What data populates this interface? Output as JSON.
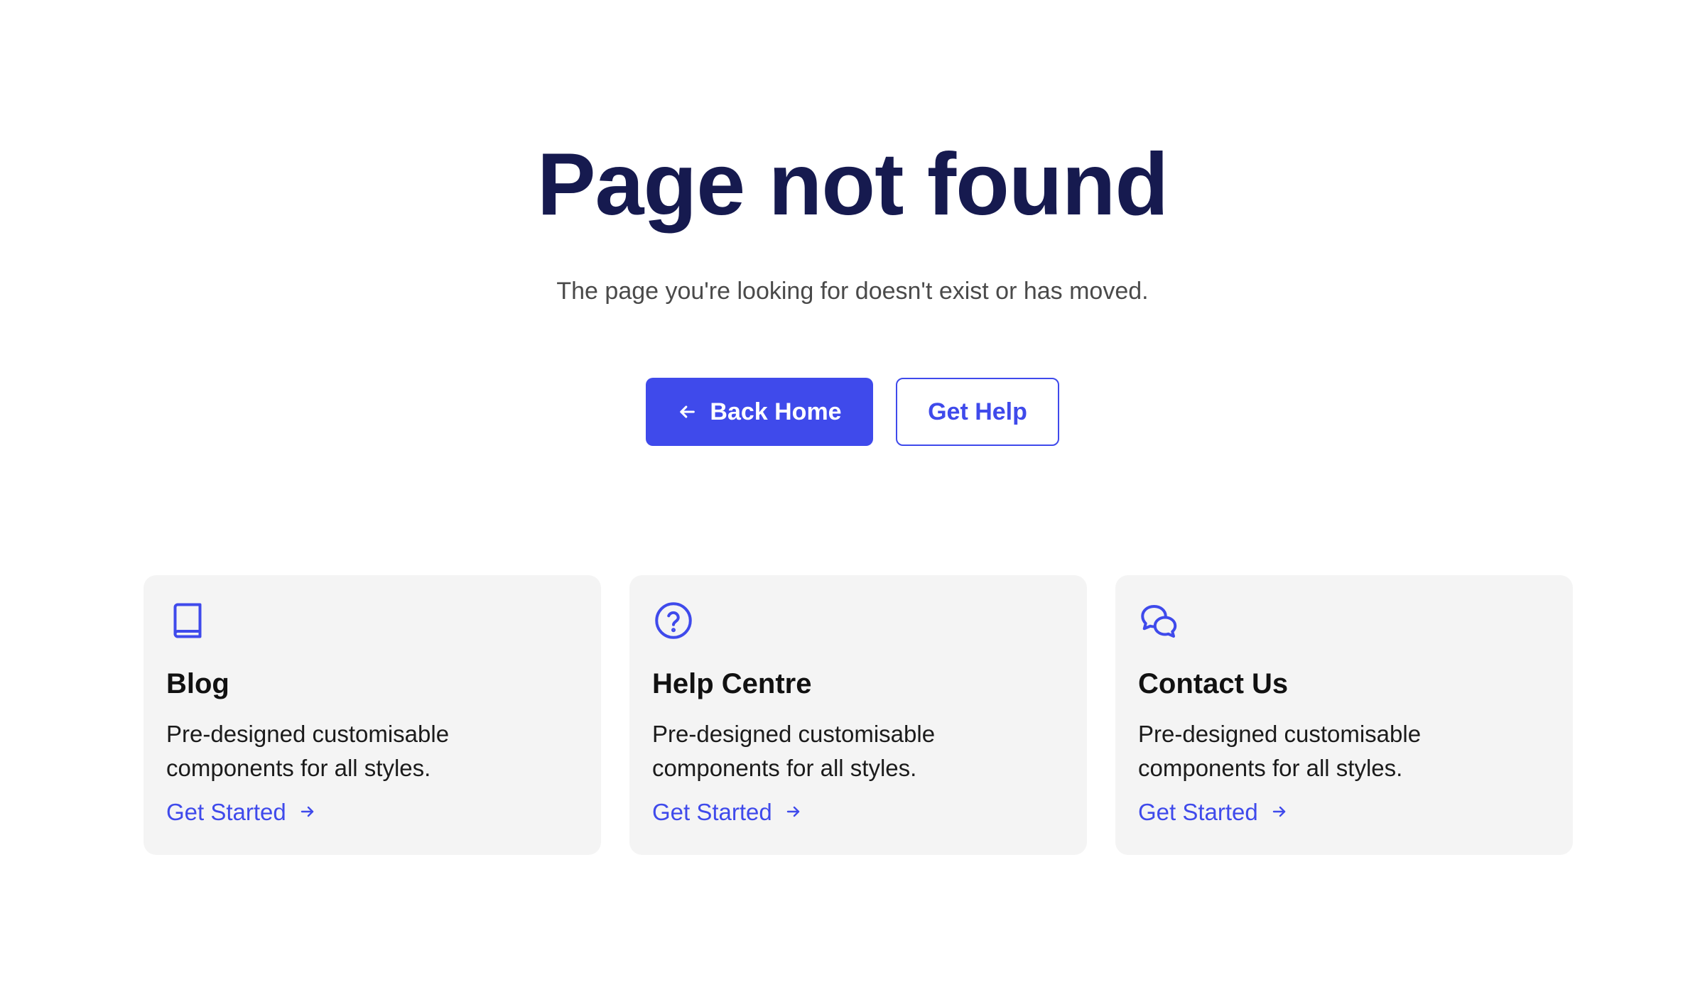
{
  "hero": {
    "title": "Page not found",
    "subtitle": "The page you're looking for doesn't exist or has moved."
  },
  "actions": {
    "back_home_label": "Back Home",
    "back_home_icon": "arrow-left-icon",
    "get_help_label": "Get Help"
  },
  "cards": [
    {
      "icon": "book-icon",
      "title": "Blog",
      "description": "Pre-designed customisable components for all styles.",
      "link_label": "Get Started",
      "link_icon": "arrow-right-icon"
    },
    {
      "icon": "question-circle-icon",
      "title": "Help Centre",
      "description": "Pre-designed customisable components for all styles.",
      "link_label": "Get Started",
      "link_icon": "arrow-right-icon"
    },
    {
      "icon": "chat-bubbles-icon",
      "title": "Contact Us",
      "description": "Pre-designed customisable components for all styles.",
      "link_label": "Get Started",
      "link_icon": "arrow-right-icon"
    }
  ],
  "colors": {
    "accent": "#3f4aeb",
    "title": "#161a4f",
    "card_background": "#f4f4f4"
  }
}
